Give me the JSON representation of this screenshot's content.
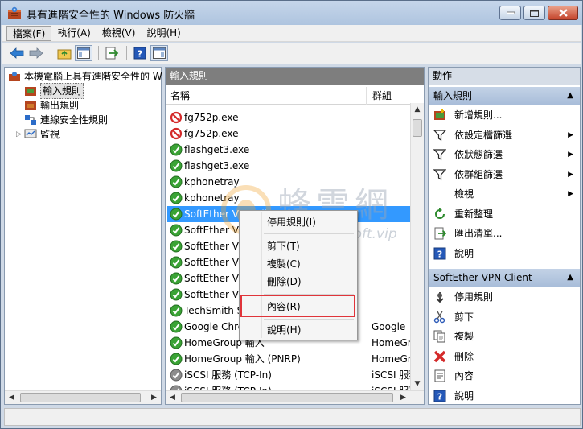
{
  "window": {
    "title": "具有進階安全性的 Windows 防火牆"
  },
  "menubar": [
    {
      "label": "檔案(F)"
    },
    {
      "label": "執行(A)"
    },
    {
      "label": "檢視(V)"
    },
    {
      "label": "說明(H)"
    }
  ],
  "tree": {
    "root": "本機電腦上具有進階安全性的 W",
    "items": [
      {
        "label": "輸入規則",
        "selected": true
      },
      {
        "label": "輸出規則"
      },
      {
        "label": "連線安全性規則"
      },
      {
        "label": "監視"
      }
    ]
  },
  "center": {
    "header": "輸入規則",
    "columns": {
      "name": "名稱",
      "group": "群組"
    },
    "rows": [
      {
        "name": "fg752p.exe",
        "group": "",
        "status": "blocked"
      },
      {
        "name": "fg752p.exe",
        "group": "",
        "status": "blocked"
      },
      {
        "name": "flashget3.exe",
        "group": "",
        "status": "allowed"
      },
      {
        "name": "flashget3.exe",
        "group": "",
        "status": "allowed"
      },
      {
        "name": "kphonetray",
        "group": "",
        "status": "allowed"
      },
      {
        "name": "kphonetray",
        "group": "",
        "status": "allowed"
      },
      {
        "name": "SoftEther VPN Client",
        "group": "",
        "status": "allowed",
        "selected": true
      },
      {
        "name": "SoftEther VP",
        "group": "",
        "status": "allowed"
      },
      {
        "name": "SoftEther VP",
        "group": "",
        "status": "allowed"
      },
      {
        "name": "SoftEther VP",
        "group": "",
        "status": "allowed"
      },
      {
        "name": "SoftEther VP",
        "group": "",
        "status": "allowed"
      },
      {
        "name": "SoftEther VP",
        "group": "",
        "status": "allowed"
      },
      {
        "name": "TechSmith S",
        "group": "",
        "status": "allowed"
      },
      {
        "name": "Google Chro",
        "group": "Google",
        "status": "allowed"
      },
      {
        "name": "HomeGroup 輸入",
        "group": "HomeGr",
        "status": "allowed"
      },
      {
        "name": "HomeGroup 輸入 (PNRP)",
        "group": "HomeGr",
        "status": "allowed"
      },
      {
        "name": "iSCSI 服務 (TCP-In)",
        "group": "iSCSI 服務",
        "status": "disabled"
      },
      {
        "name": "iSCSI 服務 (TCP-In)",
        "group": "iSCSI 服務",
        "status": "disabled"
      }
    ]
  },
  "context_menu": {
    "items": [
      {
        "label": "停用規則(I)"
      },
      {
        "label": "剪下(T)"
      },
      {
        "label": "複製(C)"
      },
      {
        "label": "刪除(D)"
      },
      {
        "label": "內容(R)",
        "highlighted": true
      },
      {
        "label": "說明(H)"
      }
    ]
  },
  "actions": {
    "header": "動作",
    "section1": {
      "title": "輸入規則",
      "items": [
        {
          "label": "新增規則...",
          "icon": "new-rule-icon"
        },
        {
          "label": "依設定檔篩選",
          "icon": "filter-icon",
          "submenu": true
        },
        {
          "label": "依狀態篩選",
          "icon": "filter-icon",
          "submenu": true
        },
        {
          "label": "依群組篩選",
          "icon": "filter-icon",
          "submenu": true
        },
        {
          "label": "檢視",
          "icon": "",
          "submenu": true
        },
        {
          "label": "重新整理",
          "icon": "refresh-icon"
        },
        {
          "label": "匯出清單...",
          "icon": "export-icon"
        },
        {
          "label": "說明",
          "icon": "help-icon"
        }
      ]
    },
    "section2": {
      "title": "SoftEther VPN Client",
      "items": [
        {
          "label": "停用規則",
          "icon": "disable-icon"
        },
        {
          "label": "剪下",
          "icon": "cut-icon"
        },
        {
          "label": "複製",
          "icon": "copy-icon"
        },
        {
          "label": "刪除",
          "icon": "delete-icon"
        },
        {
          "label": "內容",
          "icon": "properties-icon"
        },
        {
          "label": "說明",
          "icon": "help-icon"
        }
      ]
    }
  },
  "watermark": {
    "text": "蜂雲網",
    "url": "www.beesoft.vip"
  },
  "colors": {
    "selection": "#3399ff",
    "highlight_box": "#e0343a",
    "allowed": "#3aa335",
    "blocked": "#d42a2a"
  }
}
